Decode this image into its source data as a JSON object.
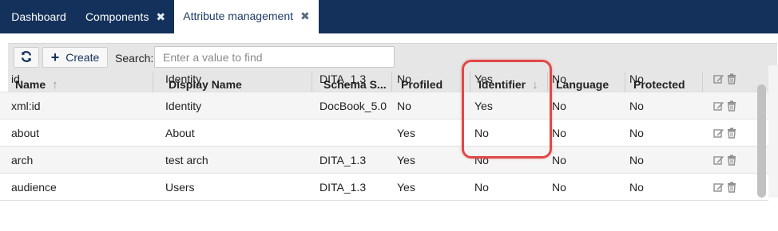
{
  "tabs": [
    {
      "label": "Dashboard",
      "closable": false
    },
    {
      "label": "Components",
      "closable": true
    },
    {
      "label": "Attribute management",
      "closable": true,
      "active": true
    }
  ],
  "toolbar": {
    "refresh_icon": "refresh-icon",
    "create_label": "Create",
    "search_label": "Search:",
    "search_placeholder": "Enter a value to find",
    "search_value": ""
  },
  "table": {
    "columns": [
      {
        "label": "Name",
        "sort": "asc"
      },
      {
        "label": "Display Name"
      },
      {
        "label": "Schema S..."
      },
      {
        "label": "Profiled"
      },
      {
        "label": "Identifier",
        "sort": "desc"
      },
      {
        "label": "Language"
      },
      {
        "label": "Protected"
      }
    ],
    "rows": [
      {
        "name": "id",
        "display_name": "Identity",
        "schema": "DITA_1.3",
        "profiled": "No",
        "identifier": "Yes",
        "language": "No",
        "protected": "No"
      },
      {
        "name": "xml:id",
        "display_name": "Identity",
        "schema": "DocBook_5.0",
        "profiled": "No",
        "identifier": "Yes",
        "language": "No",
        "protected": "No"
      },
      {
        "name": "about",
        "display_name": "About",
        "schema": "",
        "profiled": "Yes",
        "identifier": "No",
        "language": "No",
        "protected": "No"
      },
      {
        "name": "arch",
        "display_name": "test arch",
        "schema": "DITA_1.3",
        "profiled": "Yes",
        "identifier": "No",
        "language": "No",
        "protected": "No"
      },
      {
        "name": "audience",
        "display_name": "Users",
        "schema": "DITA_1.3",
        "profiled": "Yes",
        "identifier": "No",
        "language": "No",
        "protected": "No"
      }
    ],
    "row_action_icons": [
      "edit-icon",
      "trash-icon"
    ]
  },
  "colors": {
    "tabbar": "#13315a",
    "toolbar": "#e6e6e6",
    "highlight": "#e04848"
  }
}
